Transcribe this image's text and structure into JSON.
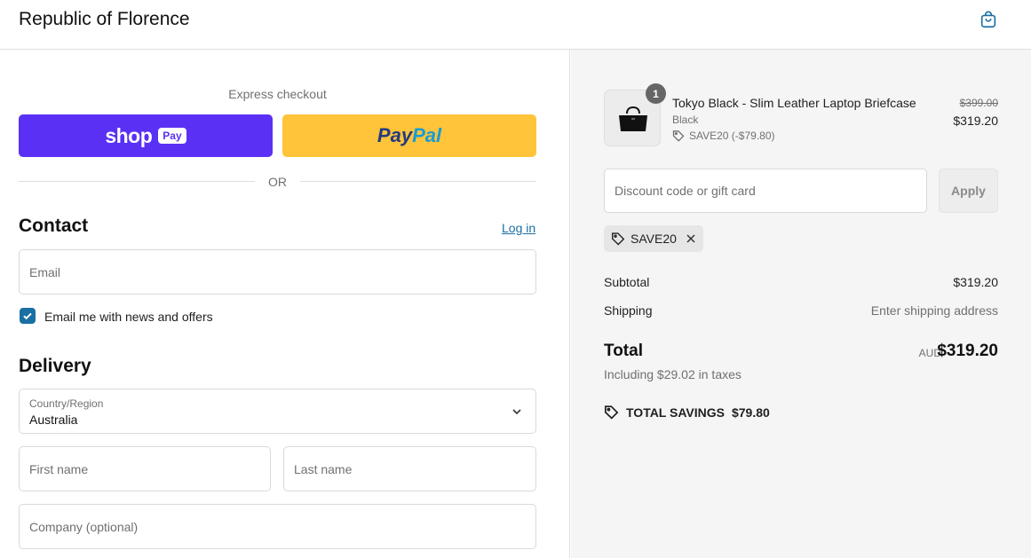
{
  "header": {
    "shop_name": "Republic of Florence",
    "cart_icon": "shopping-bag-icon"
  },
  "express": {
    "label": "Express checkout",
    "shoppay": {
      "word": "shop",
      "pay": "Pay",
      "color": "#5a31f4"
    },
    "paypal": {
      "part1": "Pay",
      "part2": "Pal",
      "color": "#ffc439"
    },
    "or_text": "OR"
  },
  "contact": {
    "title": "Contact",
    "login_link": "Log in",
    "email_placeholder": "Email",
    "newsletter_label": "Email me with news and offers",
    "newsletter_checked": true
  },
  "delivery": {
    "title": "Delivery",
    "country_label": "Country/Region",
    "country_value": "Australia",
    "first_name_placeholder": "First name",
    "last_name_placeholder": "Last name",
    "company_placeholder": "Company (optional)"
  },
  "summary": {
    "product": {
      "name": "Tokyo Black - Slim Leather Laptop Briefcase",
      "variant": "Black",
      "discount": "SAVE20 (-$79.80)",
      "quantity": "1",
      "price_original": "$399.00",
      "price_final": "$319.20"
    },
    "discount_placeholder": "Discount code or gift card",
    "apply_label": "Apply",
    "applied_code": "SAVE20",
    "subtotal_label": "Subtotal",
    "subtotal_value": "$319.20",
    "shipping_label": "Shipping",
    "shipping_value": "Enter shipping address",
    "total_label": "Total",
    "currency": "AUD",
    "total_value": "$319.20",
    "taxes": "Including $29.02 in taxes",
    "savings_label": "TOTAL SAVINGS",
    "savings_value": "$79.80"
  },
  "colors": {
    "accent": "#1a6fa3",
    "summary_bg": "#f5f5f5"
  }
}
